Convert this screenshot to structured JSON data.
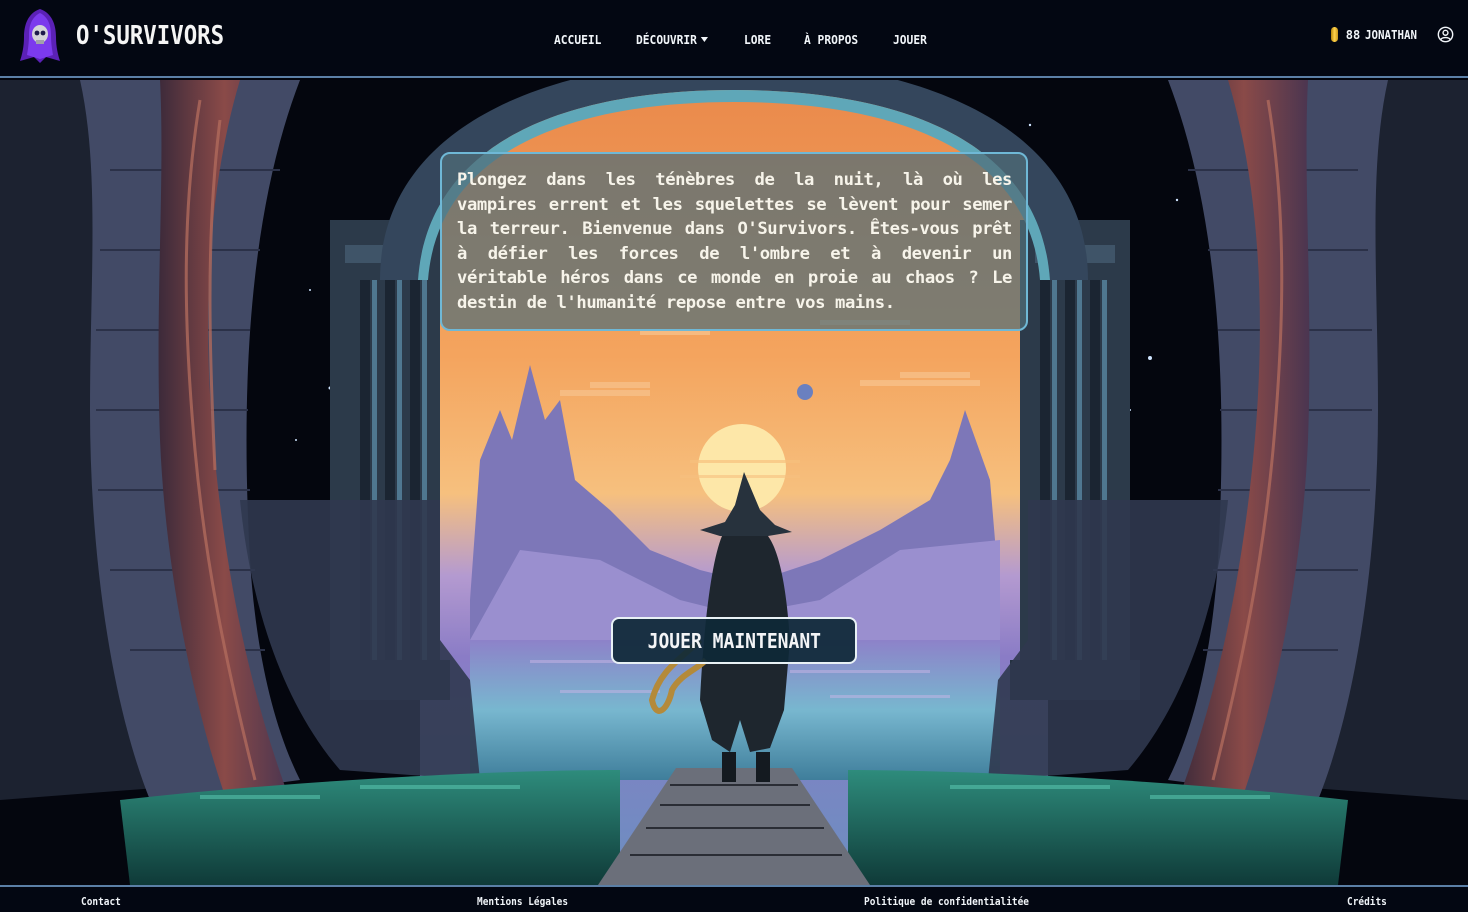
{
  "brand": {
    "name": "O'SURVIVORS",
    "logo_icon": "hooded-skull-icon"
  },
  "nav": {
    "items": [
      {
        "label": "ACCUEIL"
      },
      {
        "label": "DÉCOUVRIR",
        "has_dropdown": true
      },
      {
        "label": "LORE"
      },
      {
        "label": "À PROPOS"
      },
      {
        "label": "JOUER"
      }
    ]
  },
  "user": {
    "coins": "88",
    "coin_icon": "coin-icon",
    "name": "JONATHAN",
    "account_icon": "user-circle-icon"
  },
  "hero": {
    "intro": "Plongez dans les ténèbres de la nuit, là où les vampires errent et les squelettes se lèvent pour semer la terreur. Bienvenue dans O'Survivors. Êtes-vous prêt à défier les forces de l'ombre et à devenir un véritable héros dans ce monde en proie au chaos ? Le destin de l'humanité repose entre vos mains.",
    "cta": "JOUER MAINTENANT"
  },
  "footer": {
    "links": [
      "Contact",
      "Mentions Légales",
      "Politique de confidentialitée",
      "Crédits"
    ]
  },
  "colors": {
    "background": "#030712",
    "border_accent": "#5b7fa6",
    "box_border": "#6fb8d6",
    "sky_orange": "#f4a25a",
    "sky_purple": "#8b7bc4"
  }
}
